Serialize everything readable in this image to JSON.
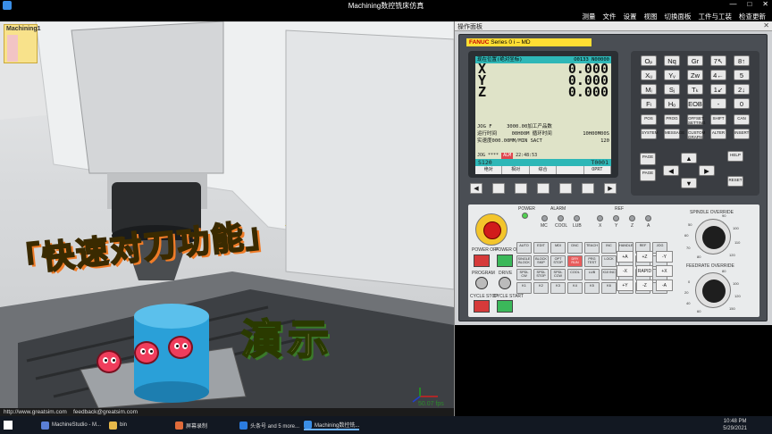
{
  "window": {
    "title": "Machining数控铣床仿真",
    "controls": [
      "—",
      "□",
      "✕"
    ]
  },
  "menu": {
    "items": [
      "测量",
      "文件",
      "设置",
      "视图",
      "切换面板",
      "工件与工装",
      "检查更新"
    ]
  },
  "viewport": {
    "doc_tab": "Machining1",
    "overlay_title": "「快速对刀功能」",
    "overlay_sub": "演示",
    "fps": "50.07 fps"
  },
  "statusbar": {
    "website": "http://www.greatsim.com",
    "feedback": "feedback@greatsim.com"
  },
  "panel": {
    "title": "操作面板",
    "brand_prefix": "FANUC",
    "brand_model": " Series 0 i – MD"
  },
  "screen": {
    "header_left": "现在位置(绝对坐标)",
    "program": "O0133 N00000",
    "axes": [
      {
        "name": "X",
        "value": "0.000"
      },
      {
        "name": "Y",
        "value": "0.000"
      },
      {
        "name": "Z",
        "value": "0.000"
      }
    ],
    "jog_f_label": "JOG F",
    "jog_f_value": "3000.00",
    "parts_label": "加工产品数",
    "run_time_label": "运行时间",
    "run_time_value": "00H00M",
    "cycle_time_label": "循环时间",
    "cycle_time_value": "10H00M00S",
    "actual_label": "实速度",
    "actual_value": "000.00MM/MIN",
    "sact_label": "SACT",
    "sact_value": "120",
    "status_bar_left": "S120",
    "status_bar_right": "T0001",
    "mode": "JOG",
    "stars": "****",
    "alm": "ALM",
    "time": "22:48:53",
    "softkeys": [
      "绝对",
      "相对",
      "综合",
      "",
      "OPRT"
    ]
  },
  "softkey_buttons": [
    "◀",
    "",
    "",
    "",
    "",
    "",
    "▶"
  ],
  "keypad": {
    "keys": [
      "Oₚ",
      "Nq",
      "Gr",
      "7↖",
      "8↑",
      "9↗",
      "Xᵤ",
      "Yᵥ",
      "Zw",
      "4←",
      "5",
      "6→",
      "Mᵢ",
      "Sⱼ",
      "Tₖ",
      "1↙",
      "2↓",
      "3↘",
      "Fₗ",
      "Hₒ",
      "EOB",
      "-",
      "0",
      ".",
      "⇧",
      "CAN",
      "INPUT"
    ],
    "function_keys": [
      "POS",
      "PROG",
      "OFFSET SETTING",
      "SHIFT",
      "CAN",
      "INPUT",
      "SYSTEM",
      "MESSAGE",
      "CUSTOM GRAPH",
      "ALTER",
      "INSERT",
      "DELETE",
      "HELP",
      "RESET"
    ],
    "page_up": "PAGE",
    "page_down": "PAGE"
  },
  "op_panel": {
    "power": "POWER",
    "alarm": "ALARM",
    "ref": "REF",
    "lamp_labels": [
      "MC",
      "COOL",
      "LUB",
      "X",
      "Y",
      "Z",
      "A"
    ],
    "power_off": "POWER OFF",
    "power_on": "POWER ON",
    "program": "PROGRAM",
    "drive": "DRIVE",
    "cycle_stop": "CYCLE STOP",
    "cycle_start": "CYCLE START",
    "spindle_override": "SPINDLE OVERRIDE",
    "feedrate_override": "FEEDRATE OVERRIDE",
    "spindle_scale": [
      "50",
      "60",
      "70",
      "80",
      "90",
      "100",
      "110",
      "120"
    ],
    "feed_scale": [
      "0",
      "20",
      "40",
      "60",
      "80",
      "100",
      "120",
      "150"
    ],
    "mode_keys": [
      "AUTO",
      "EDIT",
      "MDI",
      "DNC",
      "TEACH",
      "INC",
      "HANDLE",
      "REF",
      "JOG",
      "SINGLE BLOCK",
      "BLOCK SKIP",
      "OPT STOP",
      "DRY RUN",
      "PRG TEST",
      "LOCK",
      "",
      "",
      "",
      "SPDL CW",
      "SPDL STOP",
      "SPDL CCW",
      "COOL",
      "LUB",
      "X10 INC",
      "",
      "",
      "",
      "X1",
      "Y1",
      "Z1",
      "X1",
      "Y1",
      "Z1",
      "",
      "",
      ""
    ],
    "jog_keys": [
      "+A",
      "+Z",
      "-Y",
      "-X",
      "RAPID",
      "+X",
      "+Y",
      "-Z",
      "-A"
    ],
    "small_keys": [
      "K1",
      "K2",
      "K3",
      "K4",
      "K5",
      "K6",
      "K7",
      "K8",
      "K9"
    ]
  },
  "taskbar": {
    "items": [
      {
        "label": "MachineStudio - M...",
        "color": "#5a7fd6"
      },
      {
        "label": "bin",
        "color": "#e6b84a"
      },
      {
        "label": "屏幕录制",
        "color": "#e06b3a"
      },
      {
        "label": "头条号 and 5 more...",
        "color": "#2b7ce0"
      },
      {
        "label": "Machining数控铣...",
        "color": "#3a8ee6"
      }
    ],
    "time": "10:48 PM",
    "date": "5/29/2021"
  }
}
